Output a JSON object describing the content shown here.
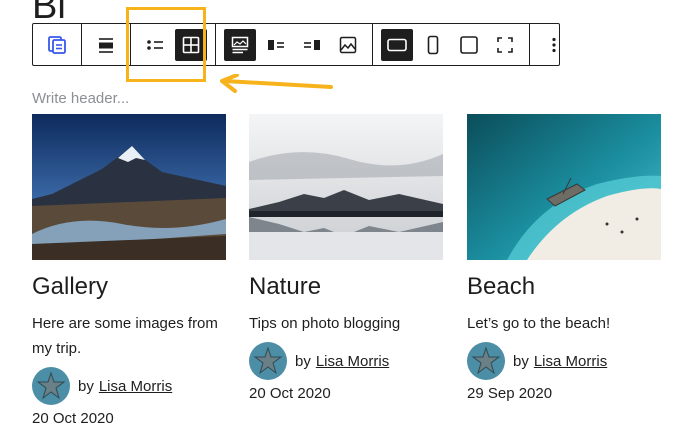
{
  "page": {
    "title_peek": "Bl"
  },
  "toolbar": {
    "groups": [
      {
        "buttons": [
          {
            "icon": "query-loop-icon",
            "active": false
          }
        ]
      },
      {
        "buttons": [
          {
            "icon": "align-icon",
            "active": false
          }
        ]
      },
      {
        "buttons": [
          {
            "icon": "list-view-icon",
            "active": false
          },
          {
            "icon": "grid-view-icon",
            "active": true
          }
        ]
      },
      {
        "buttons": [
          {
            "icon": "media-top-icon",
            "active": true
          },
          {
            "icon": "media-left-icon",
            "active": false
          },
          {
            "icon": "media-right-icon",
            "active": false
          },
          {
            "icon": "image-icon",
            "active": false
          }
        ]
      },
      {
        "buttons": [
          {
            "icon": "landscape-ratio-icon",
            "active": true
          },
          {
            "icon": "portrait-ratio-icon",
            "active": false
          },
          {
            "icon": "square-ratio-icon",
            "active": false
          },
          {
            "icon": "fullscreen-ratio-icon",
            "active": false
          }
        ]
      },
      {
        "buttons": [
          {
            "icon": "more-options-icon",
            "active": false
          }
        ]
      }
    ],
    "annotation_color": "#f6b31b"
  },
  "header": {
    "placeholder": "Write header..."
  },
  "posts": [
    {
      "title": "Gallery",
      "description": "Here are some images from my trip.",
      "by": "by",
      "author": "Lisa Morris",
      "date": "20 Oct 2020",
      "image": "mountain-landscape"
    },
    {
      "title": "Nature",
      "description": "Tips on photo blogging",
      "by": "by",
      "author": "Lisa Morris",
      "date": "20 Oct 2020",
      "image": "lake-reflection"
    },
    {
      "title": "Beach",
      "description": "Let’s go to the beach!",
      "by": "by",
      "author": "Lisa Morris",
      "date": "29 Sep 2020",
      "image": "aerial-beach-boat"
    }
  ]
}
